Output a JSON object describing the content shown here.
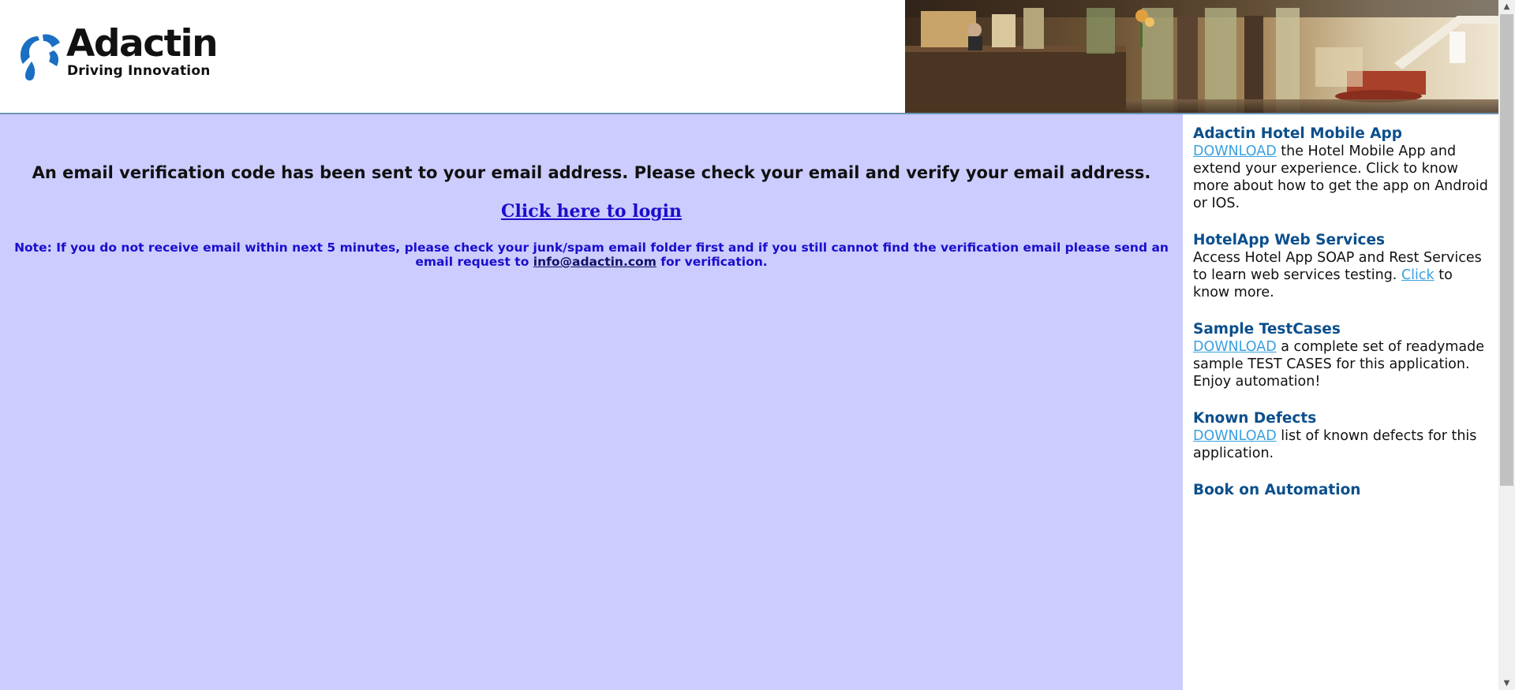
{
  "header": {
    "logo_name": "Adactin",
    "logo_tagline": "Driving Innovation",
    "banner_alt": "hotel-lobby-banner"
  },
  "main": {
    "message": "An email verification code has been sent to your email address. Please check your email and verify your email address.",
    "login_link": "Click here to login",
    "note_prefix": "Note: If you do not receive email within next 5 minutes, please check your junk/spam email folder first and if you still cannot find the verification email please send an email request to",
    "note_email": "info@adactin.com",
    "note_suffix": "for verification."
  },
  "sidebar": {
    "mobile_app": {
      "title": "Adactin Hotel Mobile App",
      "link": "DOWNLOAD",
      "text": "the Hotel Mobile App and extend your experience. Click to know more about how to get the app on Android or IOS."
    },
    "web_services": {
      "title": "HotelApp Web Services",
      "text_before": "Access Hotel App SOAP and Rest Services to learn web services testing.",
      "link": "Click",
      "text_after": "to know more."
    },
    "test_cases": {
      "title": "Sample TestCases",
      "link": "DOWNLOAD",
      "text": "a complete set of readymade sample TEST CASES for this application. Enjoy automation!"
    },
    "known_defects": {
      "title": "Known Defects",
      "link": "DOWNLOAD",
      "text": "list of known defects for this application."
    },
    "book": {
      "title": "Book on Automation"
    }
  },
  "colors": {
    "main_bg": "#ccccff",
    "link_blue": "#1a0dcc",
    "sidebar_title": "#0b4f8c",
    "sidebar_link": "#3aa0e0",
    "logo_blue": "#1b6fc2"
  }
}
